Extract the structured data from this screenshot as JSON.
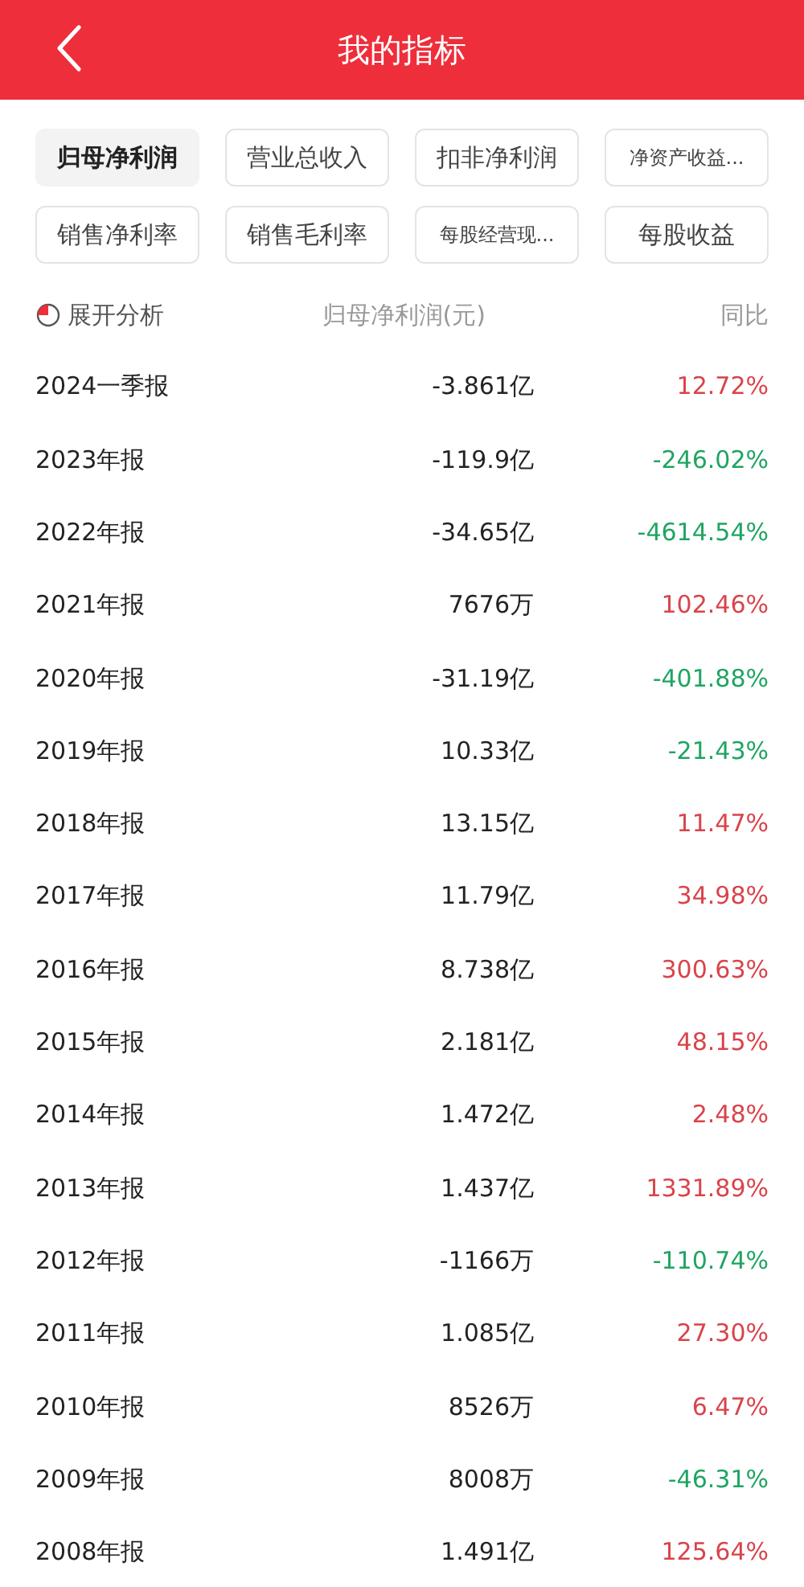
{
  "header": {
    "title": "我的指标"
  },
  "metrics": [
    {
      "label": "归母净利润",
      "selected": true
    },
    {
      "label": "营业总收入",
      "selected": false
    },
    {
      "label": "扣非净利润",
      "selected": false
    },
    {
      "label": "净资产收益...",
      "selected": false
    },
    {
      "label": "销售净利率",
      "selected": false
    },
    {
      "label": "销售毛利率",
      "selected": false
    },
    {
      "label": "每股经营现...",
      "selected": false
    },
    {
      "label": "每股收益",
      "selected": false
    }
  ],
  "table": {
    "columns": [
      "展开分析",
      "归母净利润(元)",
      "同比"
    ],
    "rows": [
      {
        "period": "2024一季报",
        "value": "-3.861亿",
        "change": "12.72%",
        "color": "#d9434a"
      },
      {
        "period": "2023年报",
        "value": "-119.9亿",
        "change": "-246.02%",
        "color": "#1fa462"
      },
      {
        "period": "2022年报",
        "value": "-34.65亿",
        "change": "-4614.54%",
        "color": "#1fa462"
      },
      {
        "period": "2021年报",
        "value": "7676万",
        "change": "102.46%",
        "color": "#d9434a"
      },
      {
        "period": "2020年报",
        "value": "-31.19亿",
        "change": "-401.88%",
        "color": "#1fa462"
      },
      {
        "period": "2019年报",
        "value": "10.33亿",
        "change": "-21.43%",
        "color": "#1fa462"
      },
      {
        "period": "2018年报",
        "value": "13.15亿",
        "change": "11.47%",
        "color": "#d9434a"
      },
      {
        "period": "2017年报",
        "value": "11.79亿",
        "change": "34.98%",
        "color": "#d9434a"
      },
      {
        "period": "2016年报",
        "value": "8.738亿",
        "change": "300.63%",
        "color": "#d9434a"
      },
      {
        "period": "2015年报",
        "value": "2.181亿",
        "change": "48.15%",
        "color": "#d9434a"
      },
      {
        "period": "2014年报",
        "value": "1.472亿",
        "change": "2.48%",
        "color": "#d9434a"
      },
      {
        "period": "2013年报",
        "value": "1.437亿",
        "change": "1331.89%",
        "color": "#d9434a"
      },
      {
        "period": "2012年报",
        "value": "-1166万",
        "change": "-110.74%",
        "color": "#1fa462"
      },
      {
        "period": "2011年报",
        "value": "1.085亿",
        "change": "27.30%",
        "color": "#d9434a"
      },
      {
        "period": "2010年报",
        "value": "8526万",
        "change": "6.47%",
        "color": "#d9434a"
      },
      {
        "period": "2009年报",
        "value": "8008万",
        "change": "-46.31%",
        "color": "#1fa462"
      },
      {
        "period": "2008年报",
        "value": "1.491亿",
        "change": "125.64%",
        "color": "#d9434a"
      }
    ]
  }
}
